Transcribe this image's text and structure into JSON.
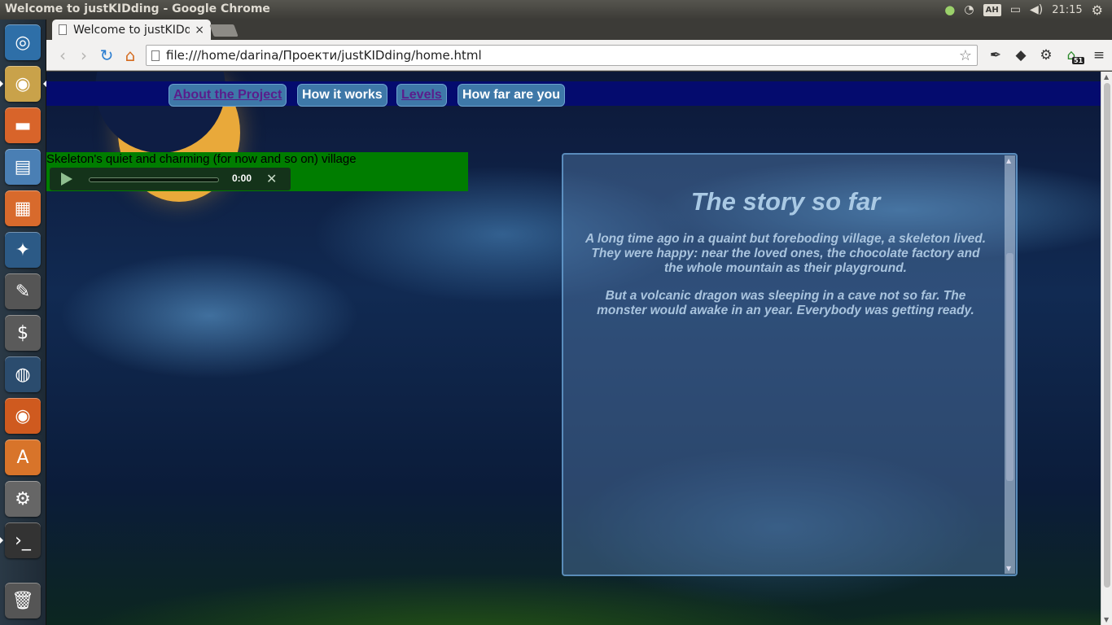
{
  "window": {
    "title": "Welcome to justKIDding - Google Chrome"
  },
  "tray": {
    "keyboard_layout": "АН",
    "clock": "21:15"
  },
  "launcher": {
    "items": [
      {
        "name": "dash-home-icon",
        "color": "#2e6fa8",
        "glyph": "◎"
      },
      {
        "name": "chrome-icon",
        "color": "#c9a24a",
        "glyph": "◉"
      },
      {
        "name": "files-icon",
        "color": "#d8642a",
        "glyph": "▬"
      },
      {
        "name": "libreoffice-writer-icon",
        "color": "#4a7fb4",
        "glyph": "▤"
      },
      {
        "name": "libreoffice-impress-icon",
        "color": "#d86a2c",
        "glyph": "▦"
      },
      {
        "name": "shotwell-icon",
        "color": "#2c5a86",
        "glyph": "✦"
      },
      {
        "name": "gimp-icon",
        "color": "#555",
        "glyph": "✎"
      },
      {
        "name": "terminal-app-icon",
        "color": "#5a5a5a",
        "glyph": "$"
      },
      {
        "name": "blender-icon",
        "color": "#2b4c6e",
        "glyph": "◍"
      },
      {
        "name": "firefox-icon",
        "color": "#cf5a1f",
        "glyph": "◉"
      },
      {
        "name": "software-center-icon",
        "color": "#d8742a",
        "glyph": "A"
      },
      {
        "name": "system-settings-icon",
        "color": "#666",
        "glyph": "⚙"
      },
      {
        "name": "terminal-icon",
        "color": "#333",
        "glyph": "›_"
      },
      {
        "name": "trash-icon",
        "color": "#555",
        "glyph": "🗑"
      }
    ]
  },
  "tab": {
    "title": "Welcome to justKIDdi",
    "close": "×"
  },
  "toolbar": {
    "back": "‹",
    "forward": "›",
    "reload": "↻",
    "home": "⌂",
    "url": "file:///home/darina/Проекти/justKIDding/home.html",
    "star": "☆",
    "ext_badge": "51"
  },
  "nav": {
    "links": [
      {
        "label": "About the Project"
      },
      {
        "label": "How it works"
      },
      {
        "label": "Levels"
      },
      {
        "label": "How far are you"
      }
    ]
  },
  "audio": {
    "caption": "Skeleton's quiet and charming (for now and so on) village",
    "time": "0:00",
    "progress": 0
  },
  "story": {
    "title": "The story so far",
    "paragraphs": [
      "A long time ago in a quaint but foreboding village, a skeleton lived. They were happy: near the loved ones, the chocolate factory and the whole mountain as their playground.",
      "But a volcanic dragon was sleeping in a cave not so far. The monster would awake in an year. Everybody was getting ready."
    ]
  },
  "colors": {
    "navbar": "#040b6e",
    "nav_button": "#3e78a8",
    "audio_block": "#007d00",
    "moon": "#e9a93a"
  }
}
